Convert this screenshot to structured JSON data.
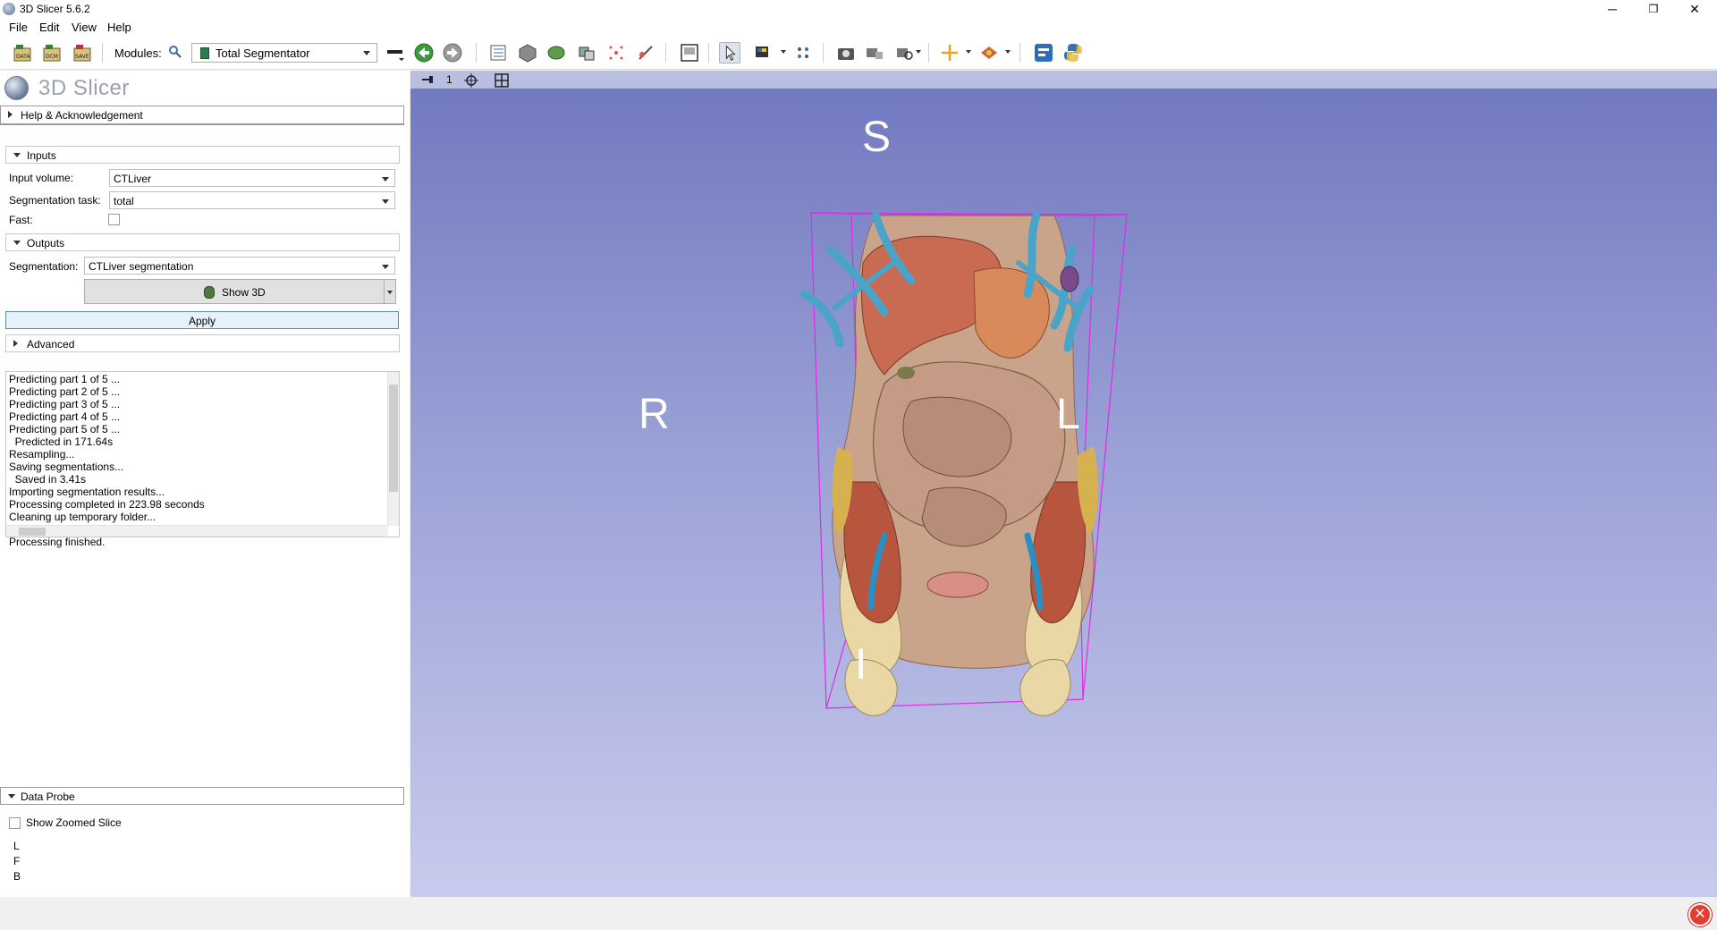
{
  "window": {
    "title": "3D Slicer 5.6.2",
    "minimize": "─",
    "restore": "❐",
    "close": "✕"
  },
  "menu": {
    "file": "File",
    "edit": "Edit",
    "view": "View",
    "help": "Help"
  },
  "toolbar": {
    "modules_label": "Modules:",
    "module_selected": "Total Segmentator"
  },
  "logo_text": "3D Slicer",
  "sections": {
    "help": "Help & Acknowledgement",
    "inputs": "Inputs",
    "outputs": "Outputs",
    "advanced": "Advanced",
    "data_probe": "Data Probe"
  },
  "inputs": {
    "input_volume_label": "Input volume:",
    "input_volume_value": "CTLiver",
    "task_label": "Segmentation task:",
    "task_value": "total",
    "fast_label": "Fast:",
    "fast_checked": false
  },
  "outputs": {
    "segmentation_label": "Segmentation:",
    "segmentation_value": "CTLiver segmentation",
    "show3d_label": "Show 3D"
  },
  "apply_label": "Apply",
  "log_lines": [
    "Predicting part 1 of 5 ...",
    "Predicting part 2 of 5 ...",
    "Predicting part 3 of 5 ...",
    "Predicting part 4 of 5 ...",
    "Predicting part 5 of 5 ...",
    "  Predicted in 171.64s",
    "Resampling...",
    "Saving segmentations...",
    "  Saved in 3.41s",
    "Importing segmentation results...",
    "Processing completed in 223.98 seconds",
    "Cleaning up temporary folder...",
    "",
    "Processing finished."
  ],
  "data_probe": {
    "show_zoomed_label": "Show Zoomed Slice",
    "coords": [
      "L",
      "F",
      "B"
    ]
  },
  "view3d": {
    "view_number": "1",
    "orientation": {
      "superior": "S",
      "inferior": "I",
      "right": "R",
      "left": "L"
    }
  },
  "colors": {
    "view_top": "#7279bf",
    "view_bottom": "#c8cbed",
    "view_header": "#b8bfe1",
    "bounding_box": "#e02ae6",
    "skin": "#c9a38a",
    "liver": "#c96a52",
    "lung_vessels": "#4aa3c9",
    "bone": "#e9d8a6"
  }
}
